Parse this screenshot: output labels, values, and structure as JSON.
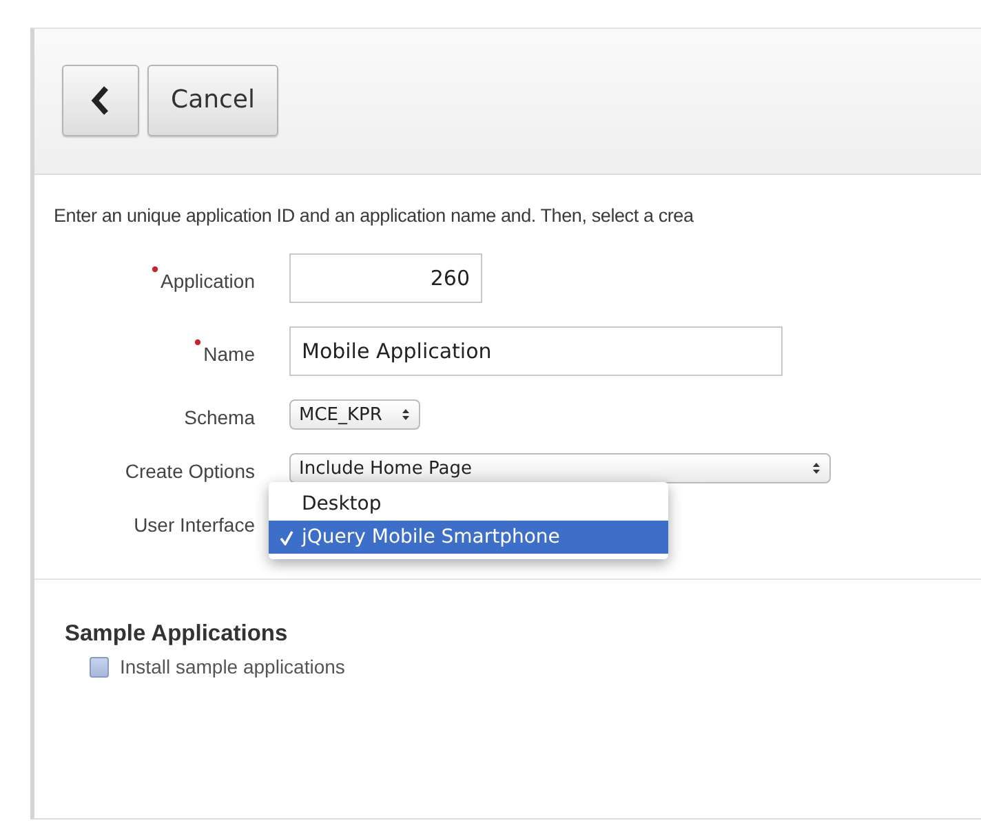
{
  "toolbar": {
    "back_button": {
      "kind": "back"
    },
    "cancel_button": {
      "label": "Cancel"
    }
  },
  "instructions": "Enter an unique application ID and an application name and. Then, select a crea",
  "form": [
    {
      "kind": "text",
      "label": "Application",
      "required": true,
      "value": "260"
    },
    {
      "kind": "text",
      "label": "Name",
      "required": true,
      "value": "Mobile Application"
    },
    {
      "kind": "select",
      "label": "Schema",
      "required": false,
      "value": "MCE_KPR"
    },
    {
      "kind": "select",
      "label": "Create Options",
      "required": false,
      "value": "Include Home Page"
    },
    {
      "kind": "menu",
      "label": "User Interface",
      "required": false,
      "options": [
        {
          "label": "Desktop",
          "selected": false
        },
        {
          "label": "jQuery Mobile Smartphone",
          "selected": true
        }
      ]
    }
  ],
  "sample_section": {
    "title": "Sample Applications",
    "checkbox": {
      "label": "Install sample applications",
      "checked": false
    }
  }
}
